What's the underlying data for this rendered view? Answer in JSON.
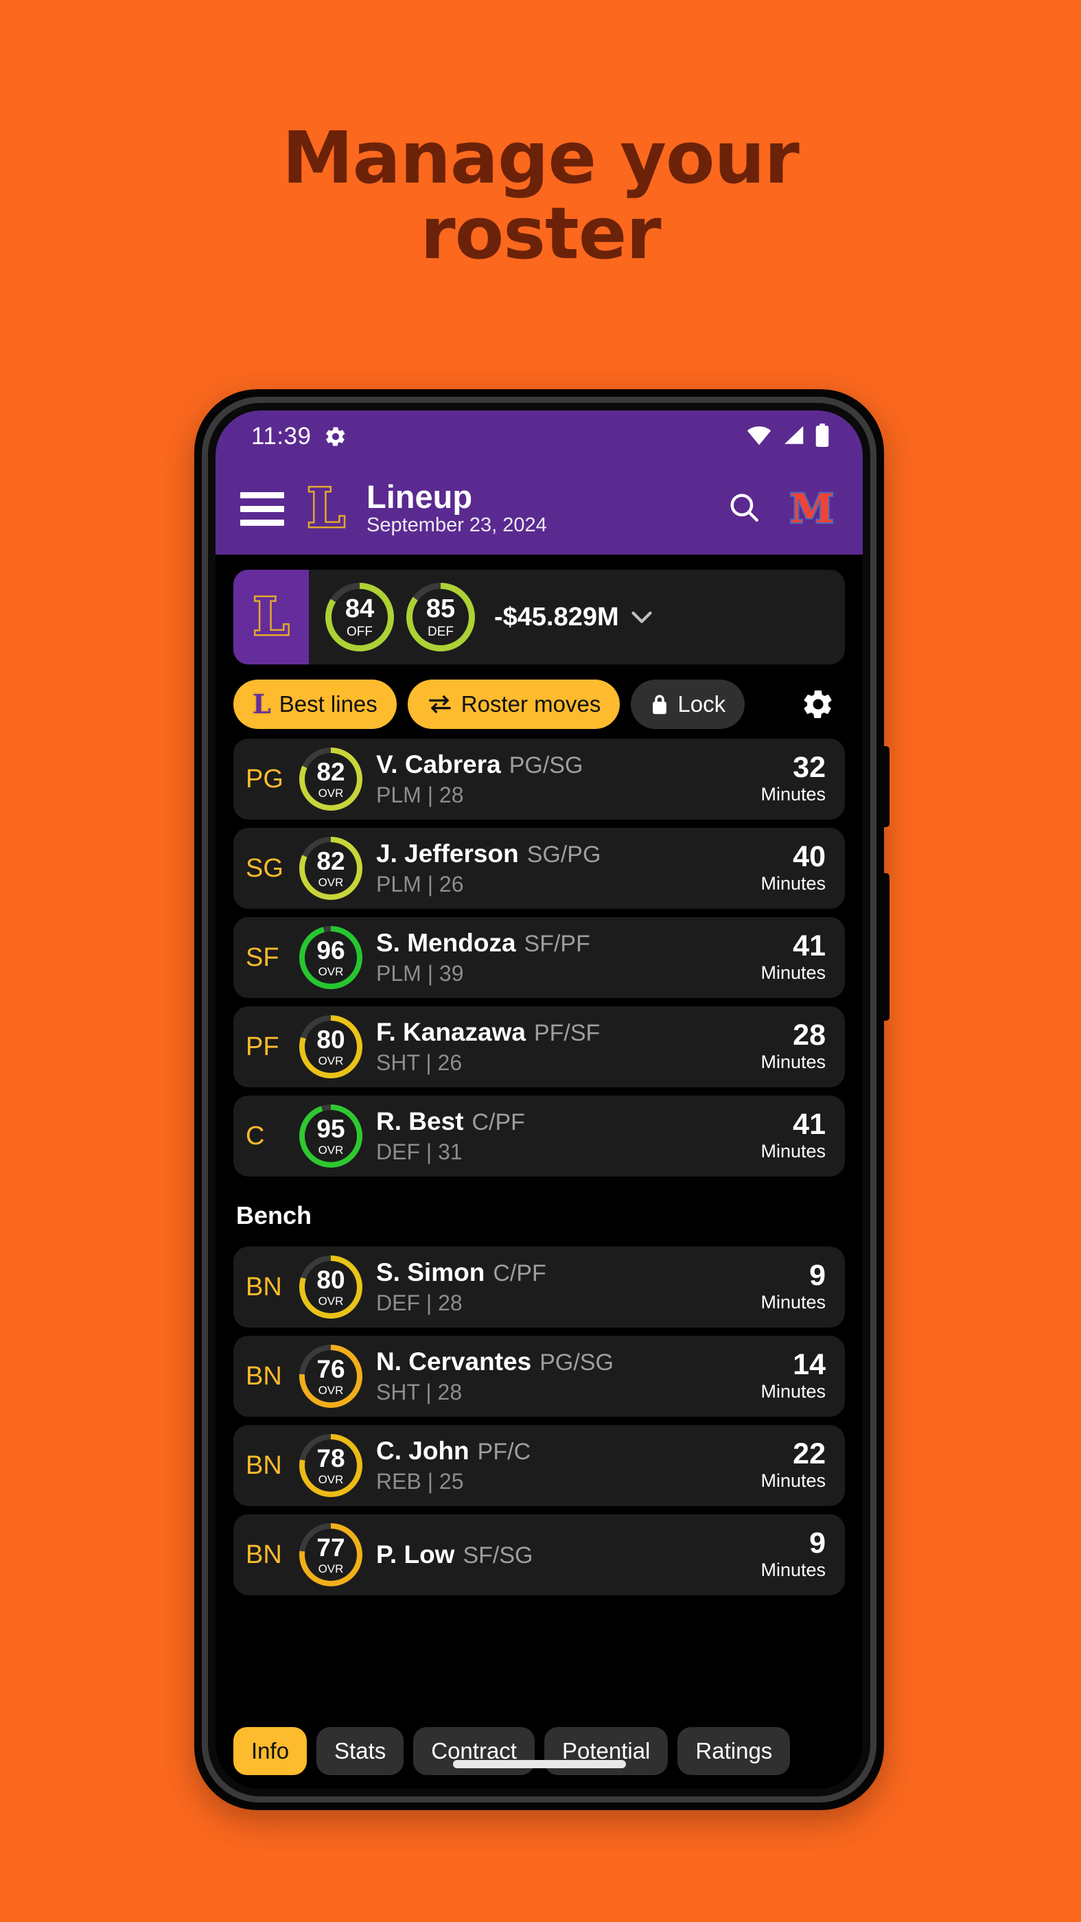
{
  "promo": {
    "headline_line1": "Manage your",
    "headline_line2": "roster",
    "bg_color": "#fb681e",
    "headline_color": "#6b2208"
  },
  "status_bar": {
    "time": "11:39",
    "gear_icon": "gear-icon",
    "wifi_icon": "wifi-icon",
    "signal_icon": "signal-icon",
    "battery_icon": "battery-icon"
  },
  "app_bar": {
    "menu_icon": "hamburger-menu-icon",
    "team_logo_letter": "L",
    "title": "Lineup",
    "subtitle": "September 23, 2024",
    "search_icon": "search-icon",
    "league_logo_letter": "M",
    "bar_color": "#5b2a91"
  },
  "team_strip": {
    "logo_letter": "L",
    "ratings": [
      {
        "value": "84",
        "label": "OFF",
        "color": "#aed136",
        "pct": 84
      },
      {
        "value": "85",
        "label": "DEF",
        "color": "#aed136",
        "pct": 85
      }
    ],
    "cap_space": "-$45.829M",
    "expand_icon": "chevron-down-icon"
  },
  "actions": [
    {
      "label": "Best lines",
      "icon": "team-l-icon",
      "style": "primary"
    },
    {
      "label": "Roster moves",
      "icon": "swap-arrows-icon",
      "style": "primary"
    },
    {
      "label": "Lock",
      "icon": "lock-icon",
      "style": "dark"
    }
  ],
  "settings_icon": "gear-icon",
  "starters": [
    {
      "pos": "PG",
      "ovr": "82",
      "ovr_label": "OVR",
      "ring_color": "#c8d53a",
      "ring_pct": 82,
      "name": "V. Cabrera",
      "positions": "PG/SG",
      "meta": "PLM | 28",
      "minutes": "32",
      "minutes_label": "Minutes"
    },
    {
      "pos": "SG",
      "ovr": "82",
      "ovr_label": "OVR",
      "ring_color": "#c8d53a",
      "ring_pct": 82,
      "name": "J. Jefferson",
      "positions": "SG/PG",
      "meta": "PLM | 26",
      "minutes": "40",
      "minutes_label": "Minutes"
    },
    {
      "pos": "SF",
      "ovr": "96",
      "ovr_label": "OVR",
      "ring_color": "#27c531",
      "ring_pct": 96,
      "name": "S. Mendoza",
      "positions": "SF/PF",
      "meta": "PLM | 39",
      "minutes": "41",
      "minutes_label": "Minutes"
    },
    {
      "pos": "PF",
      "ovr": "80",
      "ovr_label": "OVR",
      "ring_color": "#e9c318",
      "ring_pct": 80,
      "name": "F. Kanazawa",
      "positions": "PF/SF",
      "meta": "SHT | 26",
      "minutes": "28",
      "minutes_label": "Minutes"
    },
    {
      "pos": "C",
      "ovr": "95",
      "ovr_label": "OVR",
      "ring_color": "#2ec931",
      "ring_pct": 95,
      "name": "R. Best",
      "positions": "C/PF",
      "meta": "DEF | 31",
      "minutes": "41",
      "minutes_label": "Minutes"
    }
  ],
  "bench_header": "Bench",
  "bench": [
    {
      "pos": "BN",
      "ovr": "80",
      "ovr_label": "OVR",
      "ring_color": "#e9c318",
      "ring_pct": 80,
      "name": "S. Simon",
      "positions": "C/PF",
      "meta": "DEF | 28",
      "minutes": "9",
      "minutes_label": "Minutes"
    },
    {
      "pos": "BN",
      "ovr": "76",
      "ovr_label": "OVR",
      "ring_color": "#f1ad1b",
      "ring_pct": 76,
      "name": "N. Cervantes",
      "positions": "PG/SG",
      "meta": "SHT | 28",
      "minutes": "14",
      "minutes_label": "Minutes"
    },
    {
      "pos": "BN",
      "ovr": "78",
      "ovr_label": "OVR",
      "ring_color": "#edbb18",
      "ring_pct": 78,
      "name": "C. John",
      "positions": "PF/C",
      "meta": "REB | 25",
      "minutes": "22",
      "minutes_label": "Minutes"
    },
    {
      "pos": "BN",
      "ovr": "77",
      "ovr_label": "OVR",
      "ring_color": "#f1b01a",
      "ring_pct": 77,
      "name": "P. Low",
      "positions": "SF/SG",
      "meta": "",
      "minutes": "9",
      "minutes_label": "Minutes"
    }
  ],
  "tabs": [
    {
      "label": "Info",
      "active": true
    },
    {
      "label": "Stats",
      "active": false
    },
    {
      "label": "Contract",
      "active": false
    },
    {
      "label": "Potential",
      "active": false
    },
    {
      "label": "Ratings",
      "active": false
    }
  ],
  "home_indicator": "home-indicator"
}
